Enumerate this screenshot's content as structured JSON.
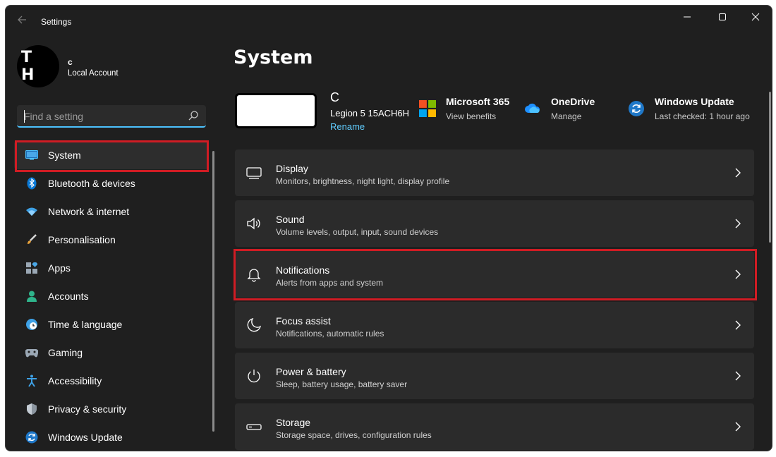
{
  "window": {
    "title": "Settings"
  },
  "account": {
    "initials": "T H",
    "name": "c",
    "type": "Local Account"
  },
  "search": {
    "placeholder": "Find a setting",
    "value": ""
  },
  "sidebar": {
    "items": [
      {
        "label": "System",
        "icon": "monitor-icon",
        "selected": true
      },
      {
        "label": "Bluetooth & devices",
        "icon": "bluetooth-icon"
      },
      {
        "label": "Network & internet",
        "icon": "wifi-icon"
      },
      {
        "label": "Personalisation",
        "icon": "brush-icon"
      },
      {
        "label": "Apps",
        "icon": "apps-icon"
      },
      {
        "label": "Accounts",
        "icon": "person-icon"
      },
      {
        "label": "Time & language",
        "icon": "globe-clock-icon"
      },
      {
        "label": "Gaming",
        "icon": "gamepad-icon"
      },
      {
        "label": "Accessibility",
        "icon": "accessibility-icon"
      },
      {
        "label": "Privacy & security",
        "icon": "shield-icon"
      },
      {
        "label": "Windows Update",
        "icon": "update-icon"
      }
    ]
  },
  "main": {
    "title": "System",
    "device": {
      "name": "C",
      "model": "Legion 5 15ACH6H",
      "rename": "Rename"
    },
    "quick": {
      "microsoft365": {
        "title": "Microsoft 365",
        "subtitle": "View benefits"
      },
      "onedrive": {
        "title": "OneDrive",
        "subtitle": "Manage"
      },
      "windows_update": {
        "title": "Windows Update",
        "subtitle": "Last checked: 1 hour ago"
      }
    },
    "cards": [
      {
        "title": "Display",
        "subtitle": "Monitors, brightness, night light, display profile",
        "icon": "display-icon"
      },
      {
        "title": "Sound",
        "subtitle": "Volume levels, output, input, sound devices",
        "icon": "speaker-icon"
      },
      {
        "title": "Notifications",
        "subtitle": "Alerts from apps and system",
        "icon": "bell-icon",
        "highlighted": true
      },
      {
        "title": "Focus assist",
        "subtitle": "Notifications, automatic rules",
        "icon": "moon-icon"
      },
      {
        "title": "Power & battery",
        "subtitle": "Sleep, battery usage, battery saver",
        "icon": "power-icon"
      },
      {
        "title": "Storage",
        "subtitle": "Storage space, drives, configuration rules",
        "icon": "storage-icon"
      }
    ]
  },
  "colors": {
    "highlight_border": "#d01c24",
    "accent": "#4cc2ff",
    "link": "#60cdff"
  }
}
